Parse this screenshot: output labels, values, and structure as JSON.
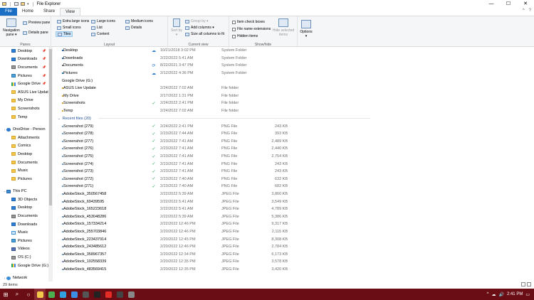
{
  "window": {
    "title": "File Explorer",
    "controls": {
      "minimize": "—",
      "maximize": "☐",
      "close": "✕"
    }
  },
  "menu": {
    "tabs": [
      "File",
      "Home",
      "Share",
      "View"
    ],
    "active_tab": "View",
    "right_icons": [
      "^",
      "?"
    ]
  },
  "ribbon": {
    "panes": {
      "navigation_pane": "Navigation pane ▾",
      "preview_pane": "Preview pane",
      "details_pane": "Details pane",
      "label": "Panes"
    },
    "layout": {
      "items": [
        "Extra large icons",
        "Large icons",
        "Medium icons",
        "Small icons",
        "List",
        "Details",
        "Tiles",
        "Content"
      ],
      "label": "Layout"
    },
    "current_view": {
      "sort_by": "Sort by ▾",
      "group_by": "Group by ▾",
      "add_columns": "Add columns ▾",
      "size_columns": "Size all columns to fit",
      "label": "Current view"
    },
    "show_hide": {
      "item_check_boxes": "Item check boxes",
      "file_name_extensions": "File name extensions",
      "hidden_items": "Hidden items",
      "hide_selected": "Hide selected items",
      "label": "Show/hide"
    },
    "options": "Options ▾"
  },
  "nav": {
    "items": [
      {
        "label": "Desktop",
        "icon": "desktop-icon",
        "pin": true,
        "indent": 1,
        "cls": "blue"
      },
      {
        "label": "Downloads",
        "icon": "downloads-icon",
        "pin": true,
        "indent": 1,
        "cls": "blue"
      },
      {
        "label": "Documents",
        "icon": "documents-icon",
        "pin": true,
        "indent": 1,
        "cls": "drive"
      },
      {
        "label": "Pictures",
        "icon": "pictures-icon",
        "pin": true,
        "indent": 1,
        "cls": "pic"
      },
      {
        "label": "Google Drive",
        "icon": "google-drive-icon",
        "pin": true,
        "indent": 1,
        "cls": "gdrive"
      },
      {
        "label": "ASUS Live Updat",
        "icon": "folder-icon",
        "pin": false,
        "indent": 1,
        "cls": "folder"
      },
      {
        "label": "My Drive",
        "icon": "folder-icon",
        "pin": false,
        "indent": 1,
        "cls": "folder"
      },
      {
        "label": "Screenshots",
        "icon": "folder-icon",
        "pin": false,
        "indent": 1,
        "cls": "folder"
      },
      {
        "label": "Temp",
        "icon": "folder-icon",
        "pin": false,
        "indent": 1,
        "cls": "folder"
      },
      {
        "label": "",
        "icon": "",
        "pin": false,
        "indent": 0,
        "cls": "",
        "spacer": true
      },
      {
        "label": "OneDrive - Person",
        "icon": "onedrive-icon",
        "pin": false,
        "indent": 0,
        "cls": "cloud",
        "arrow": "›"
      },
      {
        "label": "Attachments",
        "icon": "folder-icon",
        "pin": false,
        "indent": 1,
        "cls": "folder"
      },
      {
        "label": "Comics",
        "icon": "folder-icon",
        "pin": false,
        "indent": 1,
        "cls": "folder"
      },
      {
        "label": "Desktop",
        "icon": "folder-icon",
        "pin": false,
        "indent": 1,
        "cls": "folder"
      },
      {
        "label": "Documents",
        "icon": "folder-icon",
        "pin": false,
        "indent": 1,
        "cls": "folder"
      },
      {
        "label": "Music",
        "icon": "folder-icon",
        "pin": false,
        "indent": 1,
        "cls": "folder"
      },
      {
        "label": "Pictures",
        "icon": "folder-icon",
        "pin": false,
        "indent": 1,
        "cls": "folder"
      },
      {
        "label": "",
        "icon": "",
        "pin": false,
        "indent": 0,
        "cls": "",
        "spacer": true
      },
      {
        "label": "This PC",
        "icon": "this-pc-icon",
        "pin": false,
        "indent": 0,
        "cls": "pc",
        "arrow": "⌄"
      },
      {
        "label": "3D Objects",
        "icon": "3d-objects-icon",
        "pin": false,
        "indent": 1,
        "cls": "blue"
      },
      {
        "label": "Desktop",
        "icon": "desktop-icon",
        "pin": false,
        "indent": 1,
        "cls": "blue"
      },
      {
        "label": "Documents",
        "icon": "documents-icon",
        "pin": false,
        "indent": 1,
        "cls": "drive"
      },
      {
        "label": "Downloads",
        "icon": "downloads-icon",
        "pin": false,
        "indent": 1,
        "cls": "blue"
      },
      {
        "label": "Music",
        "icon": "music-icon",
        "pin": false,
        "indent": 1,
        "cls": "music"
      },
      {
        "label": "Pictures",
        "icon": "pictures-icon",
        "pin": false,
        "indent": 1,
        "cls": "pic"
      },
      {
        "label": "Videos",
        "icon": "videos-icon",
        "pin": false,
        "indent": 1,
        "cls": "video"
      },
      {
        "label": "OS (C:)",
        "icon": "drive-c-icon",
        "pin": false,
        "indent": 1,
        "cls": "drive"
      },
      {
        "label": "Google Drive (G:)",
        "icon": "google-drive-icon",
        "pin": false,
        "indent": 1,
        "cls": "gdrive"
      },
      {
        "label": "",
        "icon": "",
        "pin": false,
        "indent": 0,
        "cls": "",
        "spacer": true
      },
      {
        "label": "Network",
        "icon": "network-icon",
        "pin": false,
        "indent": 0,
        "cls": "net",
        "arrow": "›"
      }
    ]
  },
  "folders": [
    {
      "name": "Desktop",
      "icon": "desktop-icon",
      "cls": "blue",
      "sync": "☁",
      "syncType": "cloud",
      "date": "10/21/2018 3:02 PM",
      "type": "System Folder",
      "size": ""
    },
    {
      "name": "Downloads",
      "icon": "downloads-icon",
      "cls": "blue",
      "sync": "",
      "syncType": "",
      "date": "2/22/2022 5:41 AM",
      "type": "System Folder",
      "size": ""
    },
    {
      "name": "Documents",
      "icon": "documents-icon",
      "cls": "drive",
      "sync": "⟳",
      "syncType": "cloud",
      "date": "8/22/2021 3:47 PM",
      "type": "System Folder",
      "size": ""
    },
    {
      "name": "Pictures",
      "icon": "pictures-icon",
      "cls": "pic",
      "sync": "☁",
      "syncType": "cloud",
      "date": "2/12/2022 4:36 PM",
      "type": "System Folder",
      "size": ""
    },
    {
      "name": "Google Drive (G:)",
      "icon": "google-drive-icon",
      "cls": "gdrive",
      "sync": "",
      "syncType": "",
      "date": "",
      "type": "",
      "size": ""
    },
    {
      "name": "ASUS Live Update",
      "icon": "folder-icon",
      "cls": "folder",
      "sync": "",
      "syncType": "",
      "date": "2/24/2022 7:02 AM",
      "type": "File folder",
      "size": ""
    },
    {
      "name": "My Drive",
      "icon": "folder-icon",
      "cls": "folder",
      "sync": "",
      "syncType": "",
      "date": "2/17/2022 1:31 PM",
      "type": "File folder",
      "size": ""
    },
    {
      "name": "Screenshots",
      "icon": "folder-icon",
      "cls": "folder",
      "sync": "✓",
      "syncType": "ok",
      "date": "2/24/2022 2:41 PM",
      "type": "File folder",
      "size": ""
    },
    {
      "name": "Temp",
      "icon": "folder-icon",
      "cls": "folder",
      "sync": "",
      "syncType": "",
      "date": "2/24/2022 7:02 AM",
      "type": "File folder",
      "size": ""
    }
  ],
  "recent": {
    "header": "Recent files (20)",
    "files": [
      {
        "name": "Screenshot (279)",
        "sync": "✓",
        "date": "2/24/2022 2:41 PM",
        "type": "PNG File",
        "size": "243 KB"
      },
      {
        "name": "Screenshot (278)",
        "sync": "✓",
        "date": "2/23/2022 7:44 AM",
        "type": "PNG File",
        "size": "393 KB"
      },
      {
        "name": "Screenshot (277)",
        "sync": "✓",
        "date": "2/23/2022 7:41 AM",
        "type": "PNG File",
        "size": "2,489 KB"
      },
      {
        "name": "Screenshot (276)",
        "sync": "✓",
        "date": "2/23/2022 7:41 AM",
        "type": "PNG File",
        "size": "2,440 KB"
      },
      {
        "name": "Screenshot (275)",
        "sync": "✓",
        "date": "2/23/2022 7:41 AM",
        "type": "PNG File",
        "size": "2,754 KB"
      },
      {
        "name": "Screenshot (274)",
        "sync": "✓",
        "date": "2/23/2022 7:41 AM",
        "type": "PNG File",
        "size": "243 KB"
      },
      {
        "name": "Screenshot (273)",
        "sync": "✓",
        "date": "2/23/2022 7:41 AM",
        "type": "PNG File",
        "size": "243 KB"
      },
      {
        "name": "Screenshot (272)",
        "sync": "✓",
        "date": "2/23/2022 7:40 AM",
        "type": "PNG File",
        "size": "632 KB"
      },
      {
        "name": "Screenshot (271)",
        "sync": "✓",
        "date": "2/23/2022 7:40 AM",
        "type": "PNG File",
        "size": "682 KB"
      },
      {
        "name": "AdobeStock_350567458",
        "sync": "",
        "date": "2/22/2022 5:39 AM",
        "type": "JPEG File",
        "size": "3,860 KB"
      },
      {
        "name": "AdobeStock_69439595",
        "sync": "",
        "date": "2/22/2022 5:41 AM",
        "type": "JPEG File",
        "size": "3,549 KB"
      },
      {
        "name": "AdobeStock_165223618",
        "sync": "",
        "date": "2/22/2022 5:41 AM",
        "type": "JPEG File",
        "size": "4,789 KB"
      },
      {
        "name": "AdobeStock_453048286",
        "sync": "",
        "date": "2/22/2022 5:39 AM",
        "type": "JPEG File",
        "size": "5,386 KB"
      },
      {
        "name": "AdobeStock_157334214",
        "sync": "",
        "date": "2/22/2022 12:46 PM",
        "type": "JPEG File",
        "size": "9,317 KB"
      },
      {
        "name": "AdobeStock_255703846",
        "sync": "",
        "date": "2/20/2022 12:46 PM",
        "type": "JPEG File",
        "size": "2,115 KB"
      },
      {
        "name": "AdobeStock_223437914",
        "sync": "",
        "date": "2/20/2022 12:45 PM",
        "type": "JPEG File",
        "size": "8,308 KB"
      },
      {
        "name": "AdobeStock_243485612",
        "sync": "",
        "date": "2/20/2022 12:46 PM",
        "type": "JPEG File",
        "size": "2,784 KB"
      },
      {
        "name": "AdobeStock_358967357",
        "sync": "",
        "date": "2/20/2022 12:34 PM",
        "type": "JPEG File",
        "size": "6,173 KB"
      },
      {
        "name": "AdobeStock_102558339",
        "sync": "",
        "date": "2/20/2022 12:35 PM",
        "type": "JPEG File",
        "size": "3,578 KB"
      },
      {
        "name": "AdobeStock_483569415",
        "sync": "",
        "date": "2/20/2022 12:35 PM",
        "type": "JPEG File",
        "size": "3,420 KB"
      }
    ]
  },
  "status": {
    "items": "29 items"
  },
  "taskbar": {
    "apps": [
      {
        "name": "start-button",
        "glyph": "⊞",
        "color": ""
      },
      {
        "name": "search-button",
        "glyph": "⌕",
        "color": ""
      },
      {
        "name": "task-view-button",
        "glyph": "○",
        "color": ""
      },
      {
        "name": "file-explorer-taskbar",
        "glyph": "",
        "color": "#f3c84a"
      },
      {
        "name": "chrome-taskbar",
        "glyph": "",
        "color": "#4caf50"
      },
      {
        "name": "edge-taskbar",
        "glyph": "",
        "color": "#2fa0e0"
      },
      {
        "name": "skype-taskbar",
        "glyph": "",
        "color": "#3a8ee6"
      },
      {
        "name": "app-taskbar-1",
        "glyph": "",
        "color": "#555"
      },
      {
        "name": "app-taskbar-2",
        "glyph": "",
        "color": "#222"
      },
      {
        "name": "youtube-taskbar",
        "glyph": "",
        "color": "#e52d27"
      },
      {
        "name": "app-taskbar-3",
        "glyph": "",
        "color": "#444"
      },
      {
        "name": "app-taskbar-4",
        "glyph": "",
        "color": "#888"
      }
    ],
    "clock": "2:41 PM",
    "tray": [
      "^",
      "☁",
      "🔊"
    ]
  }
}
